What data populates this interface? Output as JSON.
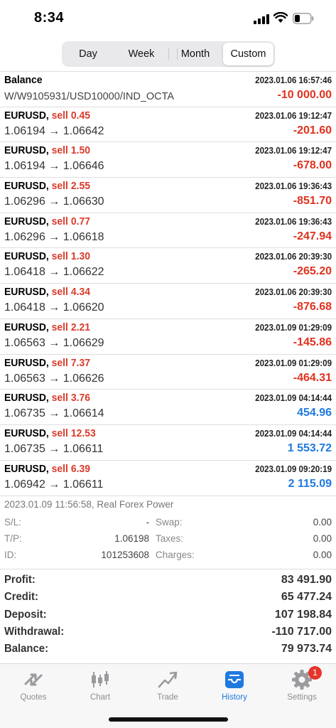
{
  "status_bar": {
    "time": "8:34"
  },
  "period_tabs": [
    "Day",
    "Week",
    "Month",
    "Custom"
  ],
  "balance_row": {
    "title": "Balance",
    "comment": "W/W9105931/USD10000/IND_OCTA",
    "date": "2023.01.06 16:57:46",
    "amount": "-10 000.00"
  },
  "deals": [
    {
      "symbol": "EURUSD,",
      "side": "sell 0.45",
      "date": "2023.01.06 19:12:47",
      "prices": "1.06194 → 1.06642",
      "profit": "-201.60",
      "sign": "neg"
    },
    {
      "symbol": "EURUSD,",
      "side": "sell 1.50",
      "date": "2023.01.06 19:12:47",
      "prices": "1.06194 → 1.06646",
      "profit": "-678.00",
      "sign": "neg"
    },
    {
      "symbol": "EURUSD,",
      "side": "sell 2.55",
      "date": "2023.01.06 19:36:43",
      "prices": "1.06296 → 1.06630",
      "profit": "-851.70",
      "sign": "neg"
    },
    {
      "symbol": "EURUSD,",
      "side": "sell 0.77",
      "date": "2023.01.06 19:36:43",
      "prices": "1.06296 → 1.06618",
      "profit": "-247.94",
      "sign": "neg"
    },
    {
      "symbol": "EURUSD,",
      "side": "sell 1.30",
      "date": "2023.01.06 20:39:30",
      "prices": "1.06418 → 1.06622",
      "profit": "-265.20",
      "sign": "neg"
    },
    {
      "symbol": "EURUSD,",
      "side": "sell 4.34",
      "date": "2023.01.06 20:39:30",
      "prices": "1.06418 → 1.06620",
      "profit": "-876.68",
      "sign": "neg"
    },
    {
      "symbol": "EURUSD,",
      "side": "sell 2.21",
      "date": "2023.01.09 01:29:09",
      "prices": "1.06563 → 1.06629",
      "profit": "-145.86",
      "sign": "neg"
    },
    {
      "symbol": "EURUSD,",
      "side": "sell 7.37",
      "date": "2023.01.09 01:29:09",
      "prices": "1.06563 → 1.06626",
      "profit": "-464.31",
      "sign": "neg"
    },
    {
      "symbol": "EURUSD,",
      "side": "sell 3.76",
      "date": "2023.01.09 04:14:44",
      "prices": "1.06735 → 1.06614",
      "profit": "454.96",
      "sign": "pos"
    },
    {
      "symbol": "EURUSD,",
      "side": "sell 12.53",
      "date": "2023.01.09 04:14:44",
      "prices": "1.06735 → 1.06611",
      "profit": "1 553.72",
      "sign": "pos"
    },
    {
      "symbol": "EURUSD,",
      "side": "sell 6.39",
      "date": "2023.01.09 09:20:19",
      "prices": "1.06942 → 1.06611",
      "profit": "2 115.09",
      "sign": "pos"
    }
  ],
  "details": {
    "header": "2023.01.09 11:56:58, Real Forex Power",
    "sl_label": "S/L:",
    "sl_value": "-",
    "tp_label": "T/P:",
    "tp_value": "1.06198",
    "id_label": "ID:",
    "id_value": "101253608",
    "swap_label": "Swap:",
    "swap_value": "0.00",
    "taxes_label": "Taxes:",
    "taxes_value": "0.00",
    "charges_label": "Charges:",
    "charges_value": "0.00"
  },
  "summary": [
    {
      "label": "Profit:",
      "value": "83 491.90"
    },
    {
      "label": "Credit:",
      "value": "65 477.24"
    },
    {
      "label": "Deposit:",
      "value": "107 198.84"
    },
    {
      "label": "Withdrawal:",
      "value": "-110 717.00"
    },
    {
      "label": "Balance:",
      "value": "79 973.74"
    }
  ],
  "tab_bar": {
    "quotes": "Quotes",
    "chart": "Chart",
    "trade": "Trade",
    "history": "History",
    "settings": "Settings",
    "settings_badge": "1",
    "active_color": "#1f7ae0",
    "inactive_color": "#8e8e93"
  },
  "colors": {
    "loss": "#e0321f",
    "profit": "#1f7ae0",
    "sell": "#d93b2b"
  }
}
